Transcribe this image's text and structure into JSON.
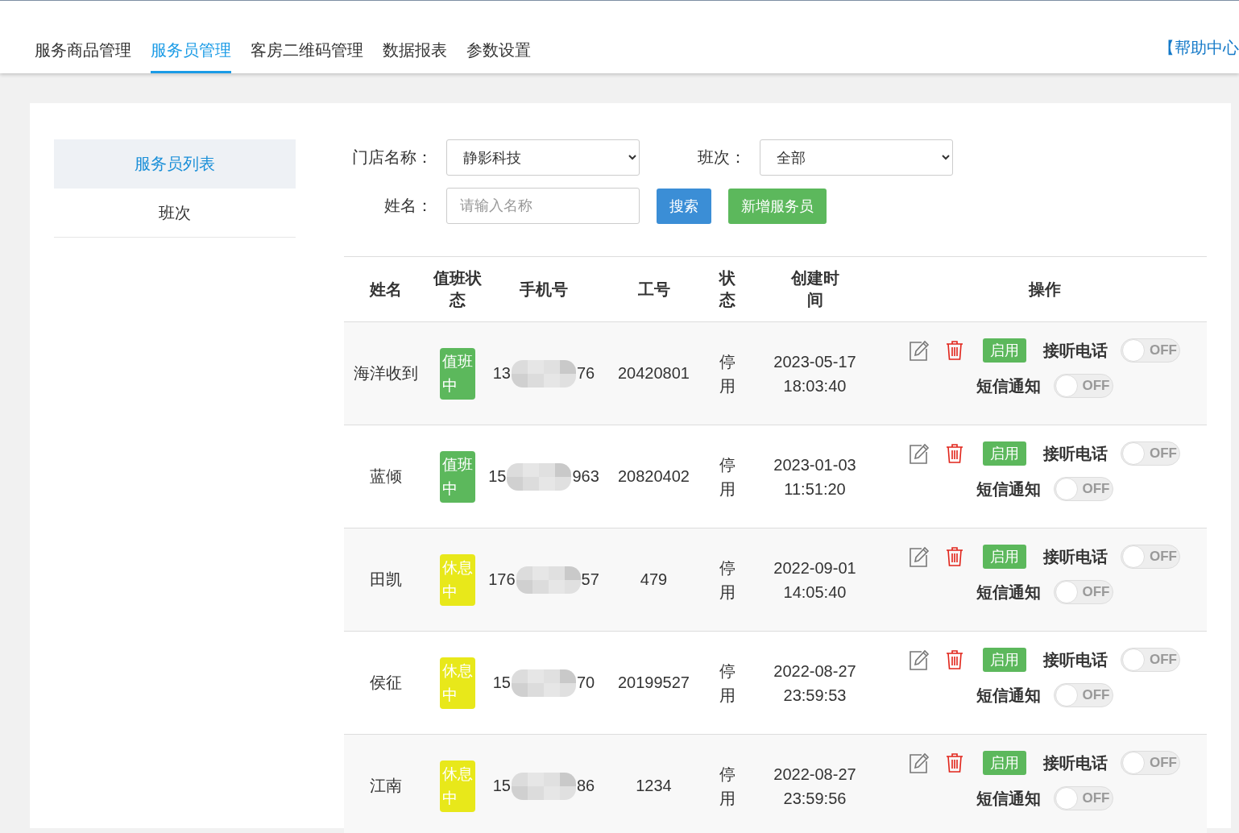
{
  "nav": {
    "tabs": [
      {
        "label": "服务商品管理",
        "selected": false
      },
      {
        "label": "服务员管理",
        "selected": true
      },
      {
        "label": "客房二维码管理",
        "selected": false
      },
      {
        "label": "数据报表",
        "selected": false
      },
      {
        "label": "参数设置",
        "selected": false
      }
    ],
    "help_link": "【帮助中心"
  },
  "sidebar": {
    "items": [
      {
        "label": "服务员列表",
        "selected": true
      },
      {
        "label": "班次",
        "selected": false
      }
    ]
  },
  "filters": {
    "store_label": "门店名称：",
    "store_value": "静影科技",
    "shift_label": "班次：",
    "shift_value": "全部",
    "name_label": "姓名：",
    "name_placeholder": "请输入名称",
    "search_button": "搜索",
    "add_button": "新增服务员"
  },
  "table": {
    "columns": [
      "姓名",
      "值班状态",
      "手机号",
      "工号",
      "状态",
      "创建时间",
      "操作"
    ],
    "rows": [
      {
        "name": "海洋收到",
        "duty": {
          "text": "值班中",
          "kind": "on_duty"
        },
        "phone_start": "13",
        "phone_end": "76",
        "employee_id": "20420801",
        "status": "停用",
        "created_date": "2023-05-17",
        "created_time": "18:03:40",
        "enable_button": "启用",
        "calls": {
          "label": "接听电话",
          "on": false,
          "text": "OFF"
        },
        "sms": {
          "label": "短信通知",
          "on": false,
          "text": "OFF"
        }
      },
      {
        "name": "蓝倾",
        "duty": {
          "text": "值班中",
          "kind": "on_duty"
        },
        "phone_start": "15",
        "phone_end": "963",
        "employee_id": "20820402",
        "status": "停用",
        "created_date": "2023-01-03",
        "created_time": "11:51:20",
        "enable_button": "启用",
        "calls": {
          "label": "接听电话",
          "on": false,
          "text": "OFF"
        },
        "sms": {
          "label": "短信通知",
          "on": false,
          "text": "OFF"
        }
      },
      {
        "name": "田凯",
        "duty": {
          "text": "休息中",
          "kind": "resting"
        },
        "phone_start": "176",
        "phone_end": "57",
        "employee_id": "479",
        "status": "停用",
        "created_date": "2022-09-01",
        "created_time": "14:05:40",
        "enable_button": "启用",
        "calls": {
          "label": "接听电话",
          "on": false,
          "text": "OFF"
        },
        "sms": {
          "label": "短信通知",
          "on": false,
          "text": "OFF"
        }
      },
      {
        "name": "侯征",
        "duty": {
          "text": "休息中",
          "kind": "resting"
        },
        "phone_start": "15",
        "phone_end": "70",
        "employee_id": "20199527",
        "status": "停用",
        "created_date": "2022-08-27",
        "created_time": "23:59:53",
        "enable_button": "启用",
        "calls": {
          "label": "接听电话",
          "on": false,
          "text": "OFF"
        },
        "sms": {
          "label": "短信通知",
          "on": false,
          "text": "OFF"
        }
      },
      {
        "name": "江南",
        "duty": {
          "text": "休息中",
          "kind": "resting"
        },
        "phone_start": "15",
        "phone_end": "86",
        "employee_id": "1234",
        "status": "停用",
        "created_date": "2022-08-27",
        "created_time": "23:59:56",
        "enable_button": "启用",
        "calls": {
          "label": "接听电话",
          "on": false,
          "text": "OFF"
        },
        "sms": {
          "label": "短信通知",
          "on": false,
          "text": "OFF"
        }
      }
    ]
  }
}
